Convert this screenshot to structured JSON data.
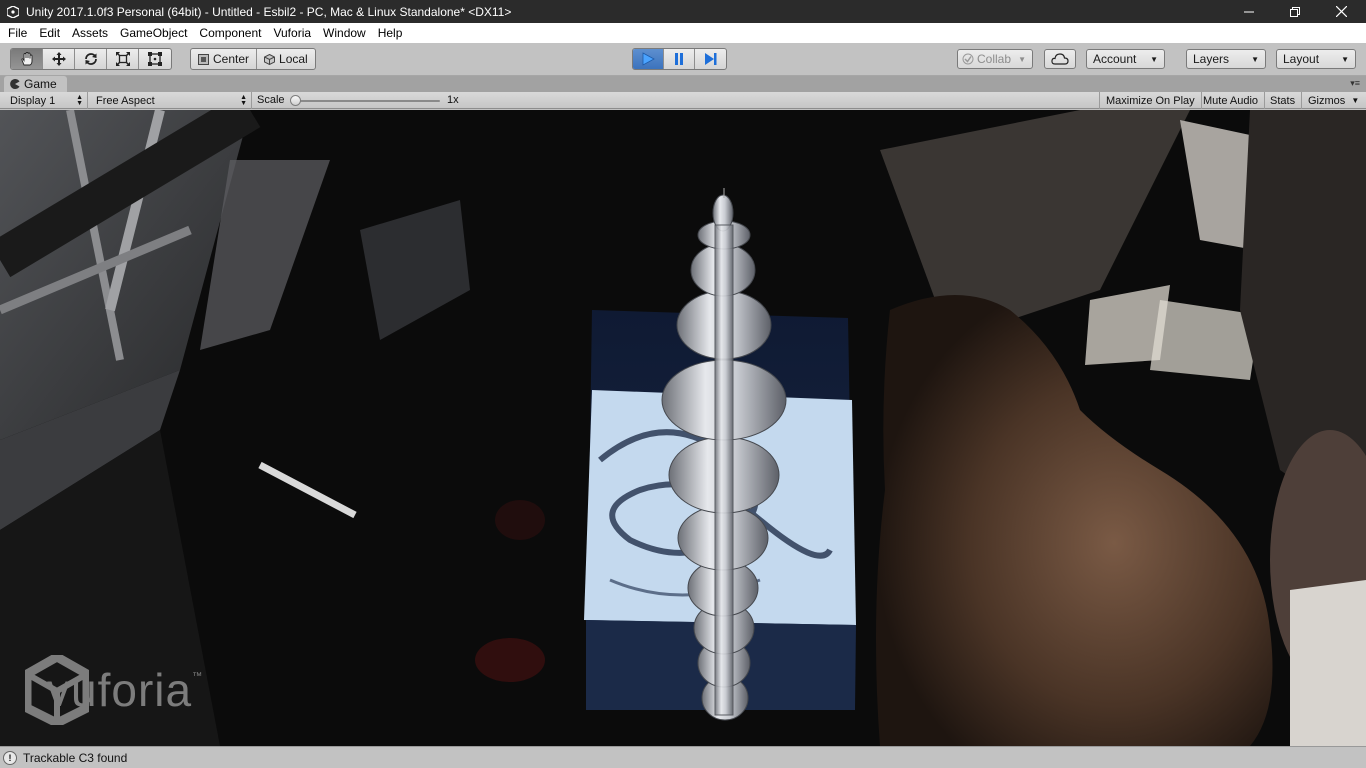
{
  "window": {
    "title": "Unity 2017.1.0f3 Personal (64bit) - Untitled - Esbil2 - PC, Mac & Linux Standalone* <DX11>",
    "app_icon": "unity-logo-icon",
    "minimize": "minimize-icon",
    "maximize": "restore-icon",
    "close": "close-icon"
  },
  "menu": {
    "items": [
      "File",
      "Edit",
      "Assets",
      "GameObject",
      "Component",
      "Vuforia",
      "Window",
      "Help"
    ]
  },
  "toolbar": {
    "tools": [
      "hand-tool-icon",
      "move-tool-icon",
      "rotate-tool-icon",
      "scale-tool-icon",
      "rect-tool-icon"
    ],
    "active_tool": "hand-tool-icon",
    "pivot_label": "Center",
    "space_label": "Local",
    "play_controls": [
      "play-icon",
      "pause-icon",
      "step-icon"
    ],
    "play_active": true,
    "collab_label": "Collab",
    "account_label": "Account",
    "layers_label": "Layers",
    "layout_label": "Layout",
    "accent_color": "#3c73bd"
  },
  "game_tab": {
    "label": "Game",
    "display": "Display 1",
    "aspect": "Free Aspect",
    "scale_label": "Scale",
    "scale_value": "1x",
    "scale_fraction": 0.0,
    "maximize_on_play": "Maximize On Play",
    "mute_audio": "Mute Audio",
    "stats": "Stats",
    "gizmos": "Gizmos"
  },
  "game_view": {
    "watermark_text": "vuforia",
    "watermark_tm": "™"
  },
  "status": {
    "message": "Trackable C3 found"
  }
}
